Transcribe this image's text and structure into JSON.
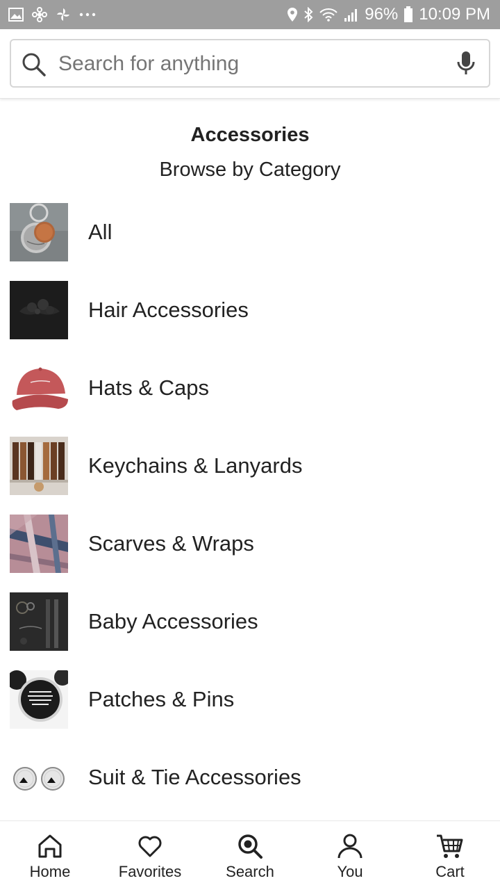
{
  "status_bar": {
    "battery_percent": "96%",
    "time": "10:09 PM",
    "left_icons": [
      "image-icon",
      "pinwheel-icon",
      "fan-icon",
      "more-dots-icon"
    ],
    "right_icons": [
      "location-icon",
      "bluetooth-icon",
      "wifi-icon",
      "signal-icon",
      "battery-icon"
    ]
  },
  "search": {
    "placeholder": "Search for anything",
    "value": ""
  },
  "header": {
    "title": "Accessories",
    "subtitle": "Browse by Category"
  },
  "categories": [
    {
      "label": "All",
      "thumbnail": "keychain-charms-thumbnail"
    },
    {
      "label": "Hair Accessories",
      "thumbnail": "hair-accessory-thumbnail"
    },
    {
      "label": "Hats & Caps",
      "thumbnail": "red-cap-thumbnail"
    },
    {
      "label": "Keychains & Lanyards",
      "thumbnail": "leather-keychains-thumbnail"
    },
    {
      "label": "Scarves & Wraps",
      "thumbnail": "plaid-scarf-thumbnail"
    },
    {
      "label": "Baby Accessories",
      "thumbnail": "baby-accessories-thumbnail"
    },
    {
      "label": "Patches & Pins",
      "thumbnail": "button-pins-thumbnail"
    },
    {
      "label": "Suit & Tie Accessories",
      "thumbnail": "cufflinks-thumbnail"
    }
  ],
  "bottom_nav": [
    {
      "label": "Home",
      "icon": "home-icon"
    },
    {
      "label": "Favorites",
      "icon": "heart-icon"
    },
    {
      "label": "Search",
      "icon": "search-nav-icon"
    },
    {
      "label": "You",
      "icon": "person-icon"
    },
    {
      "label": "Cart",
      "icon": "cart-icon"
    }
  ],
  "colors": {
    "status_bar": "#9e9e9e",
    "text": "#222222",
    "placeholder": "#757575",
    "border": "#d6d6d6"
  }
}
